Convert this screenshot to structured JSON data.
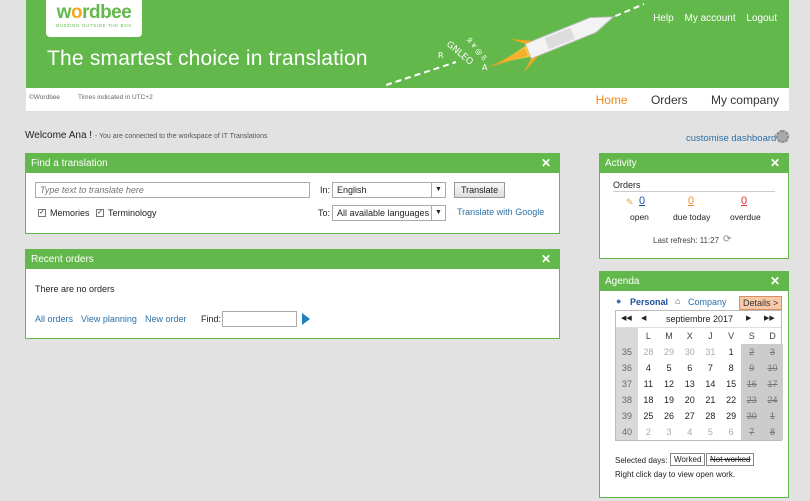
{
  "header": {
    "logo_text_1": "w",
    "logo_text_o": "o",
    "logo_text_2": "rdbee",
    "logo_tagline": "BUZZING OUTSIDE THE BOX",
    "tagline": "The smartest choice in translation",
    "links": [
      "Help",
      "My account",
      "Logout"
    ]
  },
  "subbar": {
    "copyright": "©Wordbee",
    "timezone": "Times indicated in UTC+2",
    "nav": [
      "Home",
      "Orders",
      "My company"
    ]
  },
  "welcome": {
    "greeting": "Welcome Ana !",
    "note": "- You are connected to the workspace of IT Translations",
    "customise": "customise dashboard"
  },
  "find_translation": {
    "title": "Find a translation",
    "close": "✕",
    "placeholder": "Type text to translate here",
    "in_label": "In:",
    "in_value": "English",
    "to_label": "To:",
    "to_value": "All available languages",
    "translate_button": "Translate",
    "google_link": "Translate with Google",
    "memories_label": "Memories",
    "terminology_label": "Terminology"
  },
  "recent_orders": {
    "title": "Recent orders",
    "close": "✕",
    "empty": "There are no orders",
    "links": [
      "All orders",
      "View planning",
      "New order"
    ],
    "find_label": "Find:"
  },
  "activity": {
    "title": "Activity",
    "close": "✕",
    "section": "Orders",
    "counters": [
      {
        "value": "0",
        "label": "open",
        "color": "#1a4fa0"
      },
      {
        "value": "0",
        "label": "due today",
        "color": "#f08a1c"
      },
      {
        "value": "0",
        "label": "overdue",
        "color": "#d0302a"
      }
    ],
    "refresh": "Last refresh: 11:27"
  },
  "agenda": {
    "title": "Agenda",
    "close": "✕",
    "personal": "Personal",
    "company": "Company",
    "details": "Details >",
    "month": "septiembre 2017",
    "nav": [
      "◀◀",
      "◀",
      "▶",
      "▶▶"
    ],
    "weekdays": [
      "L",
      "M",
      "X",
      "J",
      "V",
      "S",
      "D"
    ],
    "weeks": [
      {
        "n": "35",
        "days": [
          "28",
          "29",
          "30",
          "31",
          "1",
          "2",
          "3"
        ]
      },
      {
        "n": "36",
        "days": [
          "4",
          "5",
          "6",
          "7",
          "8",
          "9",
          "10"
        ]
      },
      {
        "n": "37",
        "days": [
          "11",
          "12",
          "13",
          "14",
          "15",
          "16",
          "17"
        ]
      },
      {
        "n": "38",
        "days": [
          "18",
          "19",
          "20",
          "21",
          "22",
          "23",
          "24"
        ]
      },
      {
        "n": "39",
        "days": [
          "25",
          "26",
          "27",
          "28",
          "29",
          "30",
          "1"
        ]
      },
      {
        "n": "40",
        "days": [
          "2",
          "3",
          "4",
          "5",
          "6",
          "7",
          "8"
        ]
      }
    ],
    "selected_label": "Selected days:",
    "worked": "Worked",
    "not_worked": "Not worked",
    "hint": "Right click day to view open work."
  }
}
